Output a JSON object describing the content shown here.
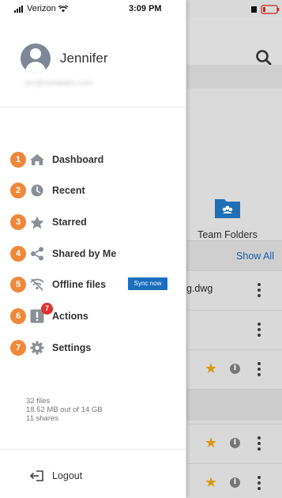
{
  "status_bar": {
    "carrier": "Verizon",
    "time": "3:09 PM"
  },
  "profile": {
    "name": "Jennifer",
    "email": "jen@sodalabs.com"
  },
  "menu": [
    {
      "num": "1",
      "label": "Dashboard",
      "icon": "home-icon"
    },
    {
      "num": "2",
      "label": "Recent",
      "icon": "clock-icon"
    },
    {
      "num": "3",
      "label": "Starred",
      "icon": "star-icon"
    },
    {
      "num": "4",
      "label": "Shared by Me",
      "icon": "share-icon"
    },
    {
      "num": "5",
      "label": "Offline files",
      "icon": "offline-icon",
      "button": "Sync now"
    },
    {
      "num": "6",
      "label": "Actions",
      "icon": "alert-icon",
      "badge": "7"
    },
    {
      "num": "7",
      "label": "Settings",
      "icon": "gear-icon"
    }
  ],
  "stats": {
    "files": "32 files",
    "storage": "18.52 MB out of 14 GB",
    "shares": "11 shares"
  },
  "logout": {
    "label": "Logout"
  },
  "background": {
    "folder_label": "Team Folders",
    "show_all": "Show All",
    "row_file": "g.dwg"
  },
  "colors": {
    "badge_orange": "#f0883a",
    "sync_blue": "#1a6fbe",
    "alert_red": "#e0302f",
    "star_gold": "#d99a12"
  }
}
